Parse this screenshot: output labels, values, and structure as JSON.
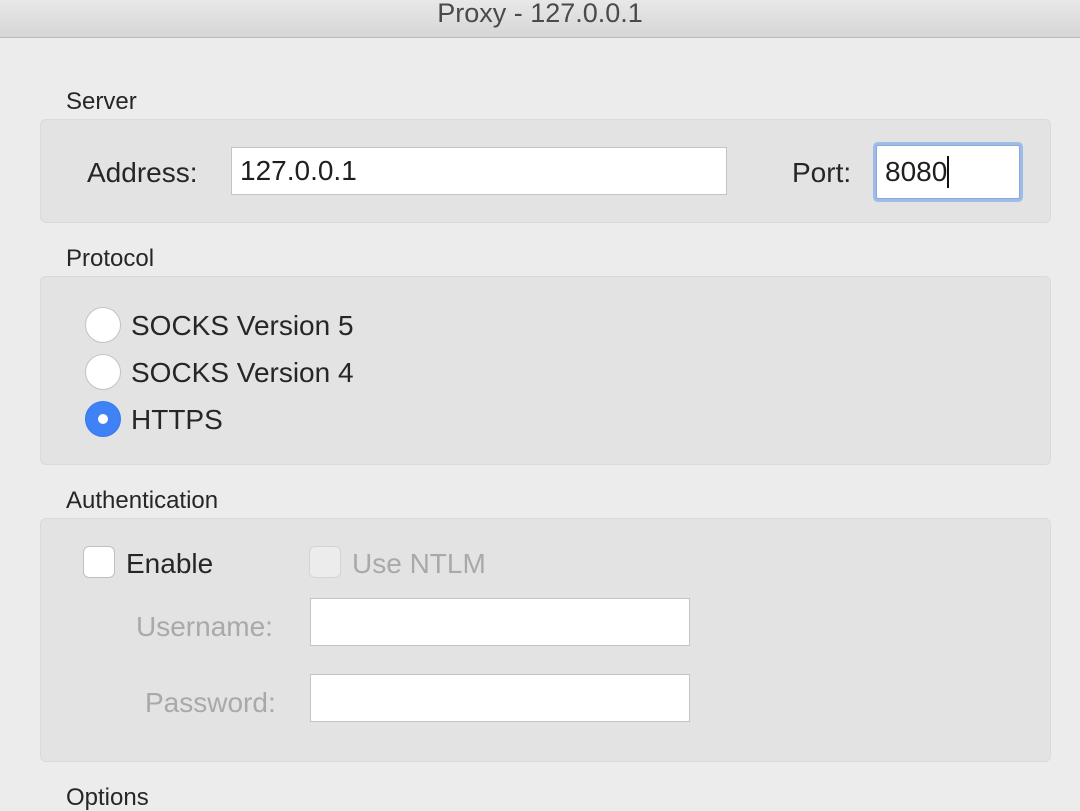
{
  "window": {
    "title": "Proxy - 127.0.0.1"
  },
  "server": {
    "section_label": "Server",
    "address_label": "Address:",
    "address_value": "127.0.0.1",
    "port_label": "Port:",
    "port_value": "8080"
  },
  "protocol": {
    "section_label": "Protocol",
    "options": [
      {
        "label": "SOCKS Version 5",
        "checked": false
      },
      {
        "label": "SOCKS Version 4",
        "checked": false
      },
      {
        "label": "HTTPS",
        "checked": true
      }
    ]
  },
  "authentication": {
    "section_label": "Authentication",
    "enable_label": "Enable",
    "enable_checked": false,
    "ntlm_label": "Use NTLM",
    "ntlm_checked": false,
    "username_label": "Username:",
    "username_value": "",
    "password_label": "Password:",
    "password_value": ""
  },
  "options": {
    "section_label": "Options"
  },
  "colors": {
    "accent": "#3e82f5",
    "focus_ring": "#9fbbe9",
    "disabled_text": "#a9a9a9"
  }
}
